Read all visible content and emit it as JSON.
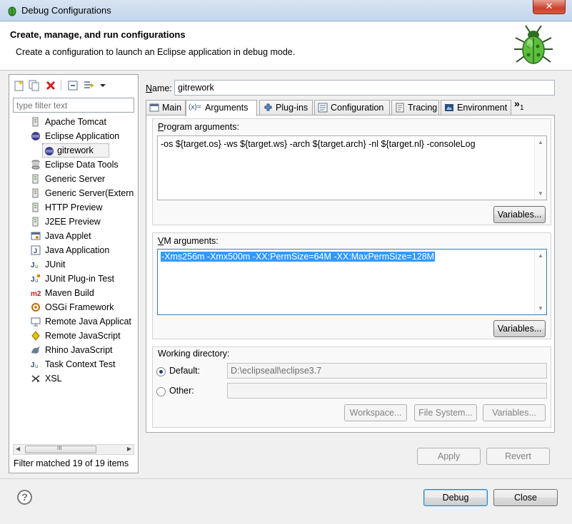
{
  "window": {
    "title": "Debug Configurations",
    "close_glyph": "✕"
  },
  "header": {
    "title": "Create, manage, and run configurations",
    "description": "Create a configuration to launch an Eclipse application in debug mode."
  },
  "left": {
    "filter_placeholder": "type filter text",
    "tree": [
      {
        "label": "Apache Tomcat",
        "icon": "server-icon",
        "indent": 0
      },
      {
        "label": "Eclipse Application",
        "icon": "eclipse-icon",
        "indent": 0
      },
      {
        "label": "gitrework",
        "icon": "eclipse-icon",
        "indent": 1,
        "selected": true
      },
      {
        "label": "Eclipse Data Tools",
        "icon": "database-icon",
        "indent": 0
      },
      {
        "label": "Generic Server",
        "icon": "server-icon",
        "indent": 0
      },
      {
        "label": "Generic Server(Extern",
        "icon": "server-icon",
        "indent": 0
      },
      {
        "label": "HTTP Preview",
        "icon": "server-icon",
        "indent": 0
      },
      {
        "label": "J2EE Preview",
        "icon": "server-icon",
        "indent": 0
      },
      {
        "label": "Java Applet",
        "icon": "applet-icon",
        "indent": 0
      },
      {
        "label": "Java Application",
        "icon": "java-app-icon",
        "indent": 0
      },
      {
        "label": "JUnit",
        "icon": "junit-icon",
        "indent": 0
      },
      {
        "label": "JUnit Plug-in Test",
        "icon": "junit-plugin-icon",
        "indent": 0
      },
      {
        "label": "Maven Build",
        "icon": "maven-icon",
        "indent": 0
      },
      {
        "label": "OSGi Framework",
        "icon": "osgi-icon",
        "indent": 0
      },
      {
        "label": "Remote Java Applicat",
        "icon": "remote-java-icon",
        "indent": 0
      },
      {
        "label": "Remote JavaScript",
        "icon": "remote-js-icon",
        "indent": 0
      },
      {
        "label": "Rhino JavaScript",
        "icon": "rhino-icon",
        "indent": 0
      },
      {
        "label": "Task Context Test",
        "icon": "task-test-icon",
        "indent": 0
      },
      {
        "label": "XSL",
        "icon": "xsl-icon",
        "indent": 0
      }
    ],
    "status": "Filter matched 19 of 19 items",
    "scroll_thumb_glyph": "III"
  },
  "right": {
    "name_label": "Name:",
    "name_value": "gitrework",
    "tabs": [
      "Main",
      "Arguments",
      "Plug-ins",
      "Configuration",
      "Tracing",
      "Environment"
    ],
    "tab_icon_args": "(x)=",
    "tabs_overflow": "»",
    "tabs_overflow_count": "1",
    "program_args_label": "Program arguments:",
    "program_args": "-os ${target.os} -ws ${target.ws} -arch ${target.arch} -nl ${target.nl} -consoleLog",
    "vm_args_label": "VM arguments:",
    "vm_args": "-Xms256m -Xmx500m -XX:PermSize=64M -XX:MaxPermSize=128M",
    "variables_button": "Variables...",
    "working_dir_label": "Working directory:",
    "default_label": "Default:",
    "default_value": "D:\\eclipseall\\eclipse3.7",
    "other_label": "Other:",
    "workspace_button": "Workspace...",
    "filesystem_button": "File System...",
    "variables_button_3": "Variables..."
  },
  "footer": {
    "apply": "Apply",
    "revert": "Revert",
    "debug": "Debug",
    "close": "Close",
    "help_glyph": "?"
  },
  "scroll_up_glyph": "▲",
  "scroll_down_glyph": "▼",
  "colors": {
    "selection": "#3399ff",
    "window_bg": "#f0f0f0"
  }
}
